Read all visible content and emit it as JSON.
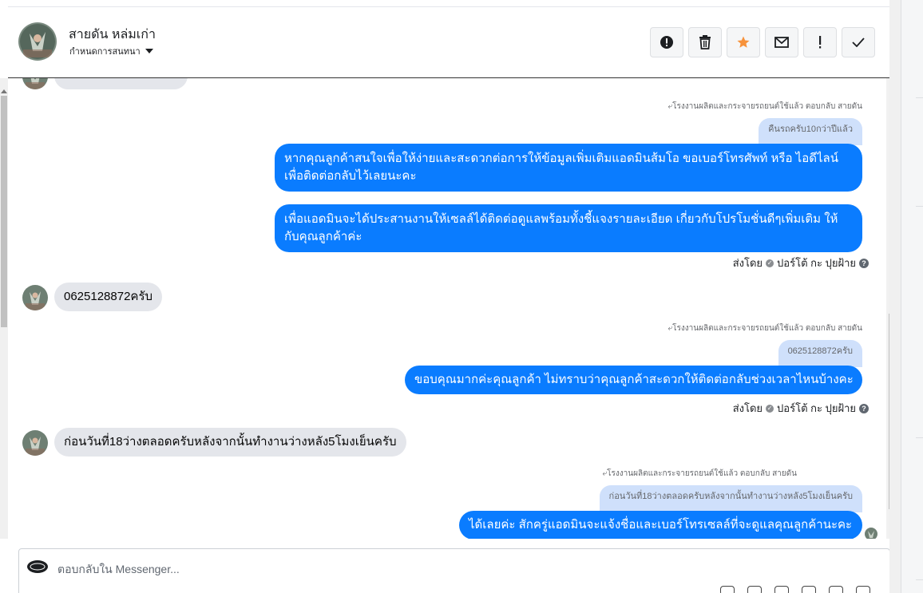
{
  "header": {
    "contact_name": "สายดัน หล่มเก่า",
    "assign_label": "กำหนดการสนทนา",
    "actions": [
      {
        "name": "report-button",
        "icon": "alert-circle-icon"
      },
      {
        "name": "delete-button",
        "icon": "trash-icon"
      },
      {
        "name": "star-button",
        "icon": "star-icon"
      },
      {
        "name": "mark-unread-button",
        "icon": "envelope-icon"
      },
      {
        "name": "spam-button",
        "icon": "exclamation-icon"
      },
      {
        "name": "done-button",
        "icon": "checkmark-icon"
      }
    ]
  },
  "messages": {
    "reply_note_1": "โรงงานผลิตและกระจายรถยนต์ใช้แล้ว ตอบกลับ สายดัน",
    "quote_1": "คืนรถครับ10กว่าปีแล้ว",
    "out_1_line1": "หากคุณลูกค้าสนใจเพื่อให้ง่ายและสะดวกต่อการให้ข้อมูลเพิ่มเติมแอดมินส้มโอ ขอเบอร์โทรศัพท์ หรือ ไอดีไลน์",
    "out_1_line2": "เพื่อติดต่อกลับไว้เลยนะคะ",
    "out_2_line1": "เพื่อแอดมินจะได้ประสานงานให้เซลล์ได้ติดต่อดูแลพร้อมทั้งชี้แจงรายละเอียด เกี่ยวกับโปรโมชั่นดีๆเพิ่มเติม ให้",
    "out_2_line2": "กับคุณลูกค้าค่ะ",
    "sent_by_1": "ส่งโดย",
    "sender_1": "ปอร์โต้ กะ ปุยฝ้าย",
    "in_1": "0625128872ครับ",
    "reply_note_2": "โรงงานผลิตและกระจายรถยนต์ใช้แล้ว ตอบกลับ สายดัน",
    "quote_2": "0625128872ครับ",
    "out_3": "ขอบคุณมากค่ะคุณลูกค้า ไม่ทราบว่าคุณลูกค้าสะดวกให้ติดต่อกลับช่วงเวลาไหนบ้างคะ",
    "sent_by_2": "ส่งโดย",
    "sender_2": "ปอร์โต้ กะ ปุยฝ้าย",
    "in_2": "ก่อนวันที่18ว่างตลอดครับหลังจากนั้นทำงานว่างหลัง5โมงเย็นครับ",
    "reply_note_3": "โรงงานผลิตและกระจายรถยนต์ใช้แล้ว ตอบกลับ สายดัน",
    "quote_3": "ก่อนวันที่18ว่างตลอดครับหลังจากนั้นทำงานว่างหลัง5โมงเย็นครับ",
    "out_4": "ได้เลยค่ะ สักครู่แอดมินจะแจ้งชื่อและเบอร์โทรเซลล์ที่จะดูแลคุณลูกค้านะคะ"
  },
  "composer": {
    "placeholder": "ตอบกลับใน Messenger..."
  },
  "colors": {
    "outgoing_bubble": "#0a7cff",
    "incoming_bubble": "#e4e6eb",
    "quote_bubble": "#cfe0fb",
    "star": "#f7923b"
  }
}
